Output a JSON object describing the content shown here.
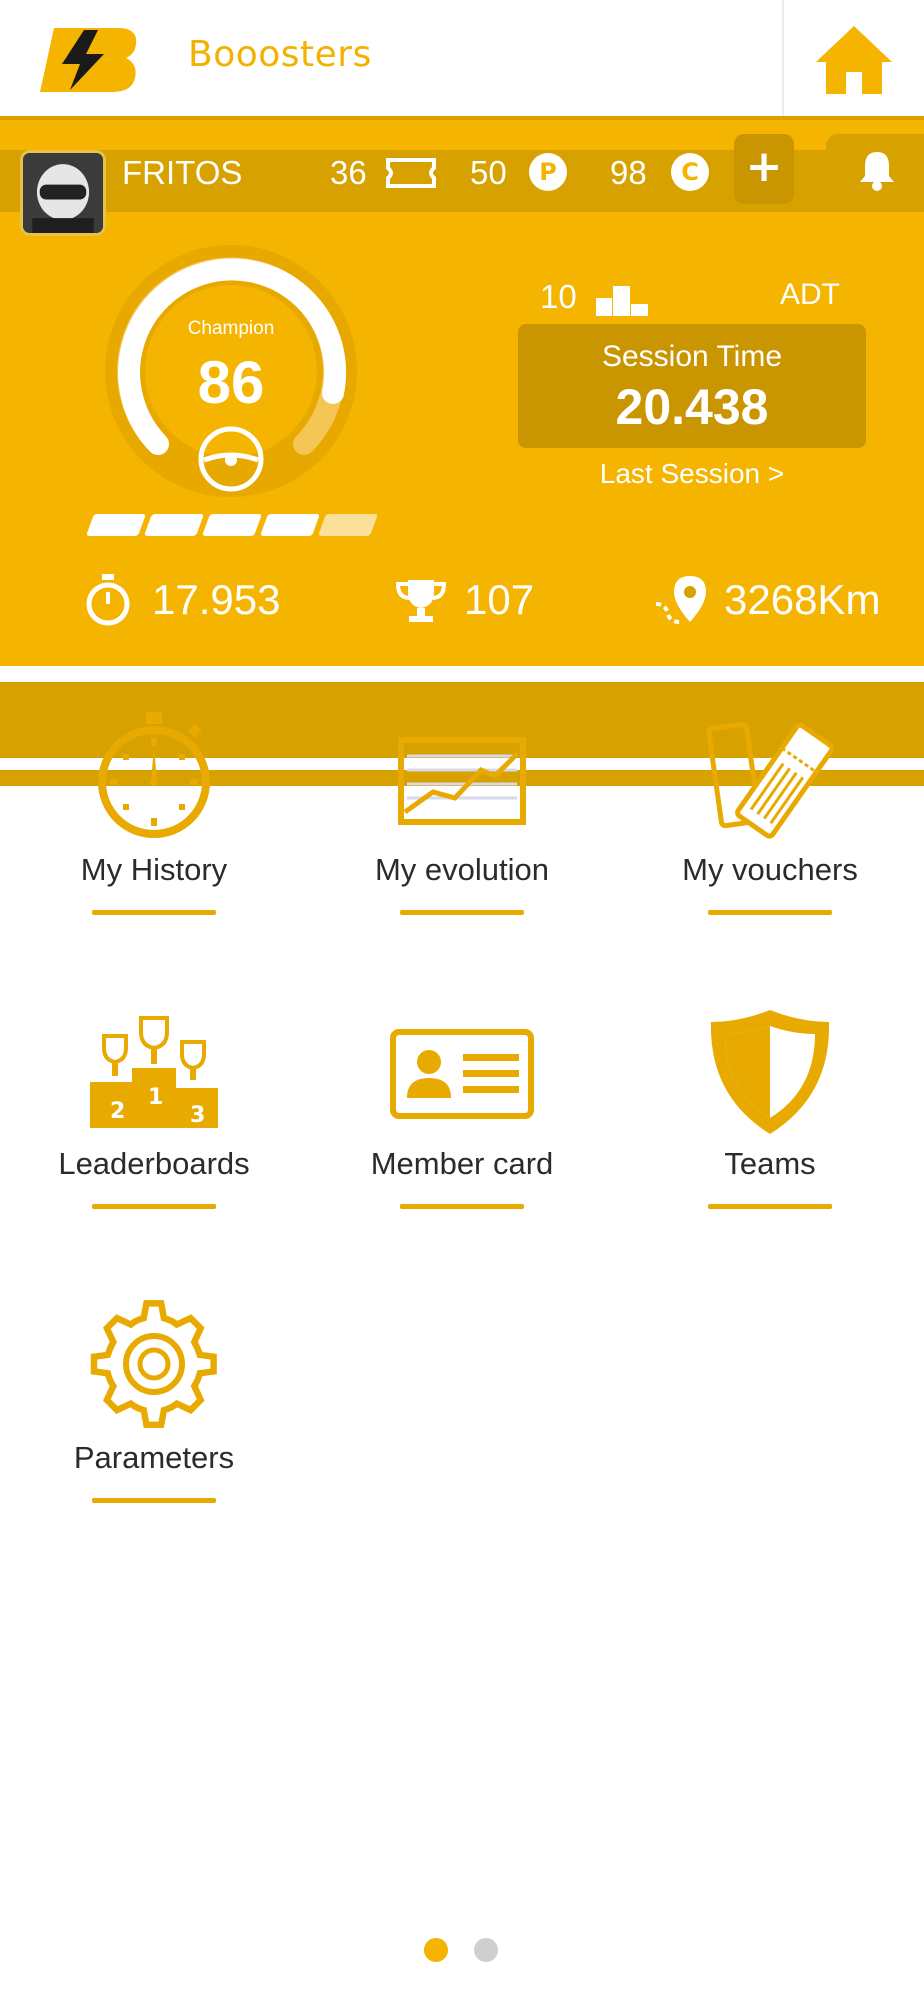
{
  "app": {
    "title": "Booosters"
  },
  "profile": {
    "username": "FRITOS",
    "tickets": "36",
    "points": "50",
    "credits": "98",
    "add_label": "+"
  },
  "level": {
    "rank_title": "Champion",
    "value": "86",
    "progress_steps": 5,
    "filled_steps": 4
  },
  "session": {
    "position": "10",
    "track": "ADT",
    "title": "Session Time",
    "time": "20.438",
    "last_session_label": "Last Session >"
  },
  "stats": {
    "best_time": "17.953",
    "trophies": "107",
    "distance": "3268Km"
  },
  "menu": [
    {
      "label": "My History",
      "icon": "stopwatch-icon"
    },
    {
      "label": "My evolution",
      "icon": "line-chart-icon"
    },
    {
      "label": "My vouchers",
      "icon": "tickets-icon"
    },
    {
      "label": "Leaderboards",
      "icon": "podium-trophy-icon"
    },
    {
      "label": "Member card",
      "icon": "id-card-icon"
    },
    {
      "label": "Teams",
      "icon": "shield-icon"
    },
    {
      "label": "Parameters",
      "icon": "gear-icon"
    }
  ],
  "pager": {
    "pages": 2,
    "active": 1
  },
  "colors": {
    "accent": "#f5b400",
    "accent_dark": "#d7a100",
    "icon": "#e8a900",
    "dot_inactive": "#cfcfcf"
  }
}
